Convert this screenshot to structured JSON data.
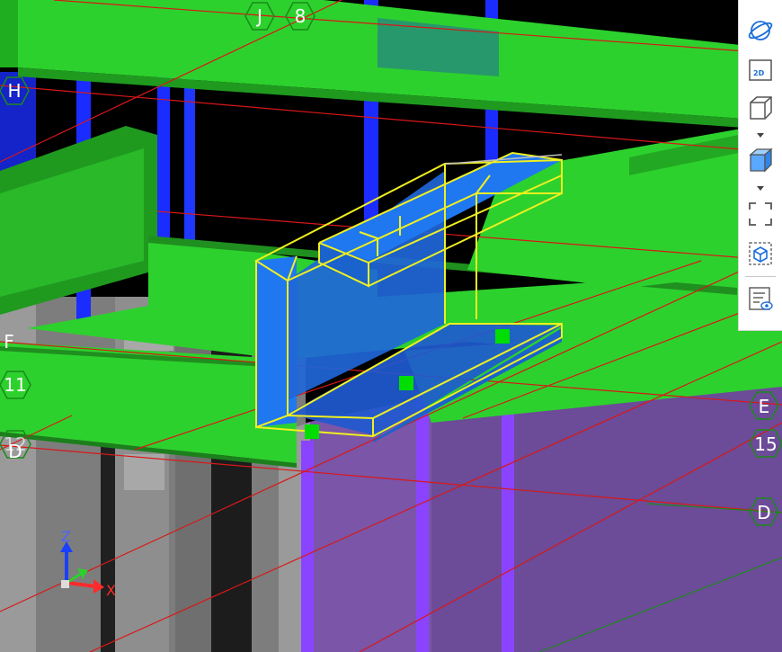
{
  "viewport": {
    "grid_labels": {
      "j": "J",
      "eight": "8",
      "h": "H",
      "f": "F",
      "eleven": "11",
      "twelve": "12",
      "d_left": "D",
      "e_right": "E",
      "fifteen": "15",
      "d_right": "D"
    },
    "axis_triad": {
      "z": "Z",
      "y": "Y",
      "x": "X"
    },
    "colors": {
      "background": "#000000",
      "slab": "#2dd12d",
      "column": "#1a2cff",
      "wall": "#8c8c8c",
      "purple_panel": "#7a55a8",
      "selection_outline": "#f0f020",
      "selected_fill": "#1f78f0",
      "grid_line": "#d81818",
      "grip": "#00dd00",
      "axis_x": "#ff2a2a",
      "axis_y": "#2bd12b",
      "axis_z": "#1a40ff"
    }
  },
  "toolbar": {
    "buttons": [
      {
        "name": "orbit",
        "icon": "orbit-icon"
      },
      {
        "name": "2d-view",
        "icon": "2d-view-icon",
        "label": "2D"
      },
      {
        "name": "wireframe-cube",
        "icon": "wireframe-cube-icon"
      },
      {
        "name": "shaded-cube",
        "icon": "shaded-cube-icon"
      },
      {
        "name": "zoom-extents",
        "icon": "zoom-extents-icon"
      },
      {
        "name": "zoom-selected",
        "icon": "zoom-selected-icon"
      },
      {
        "name": "visibility-list",
        "icon": "visibility-list-icon"
      }
    ]
  }
}
